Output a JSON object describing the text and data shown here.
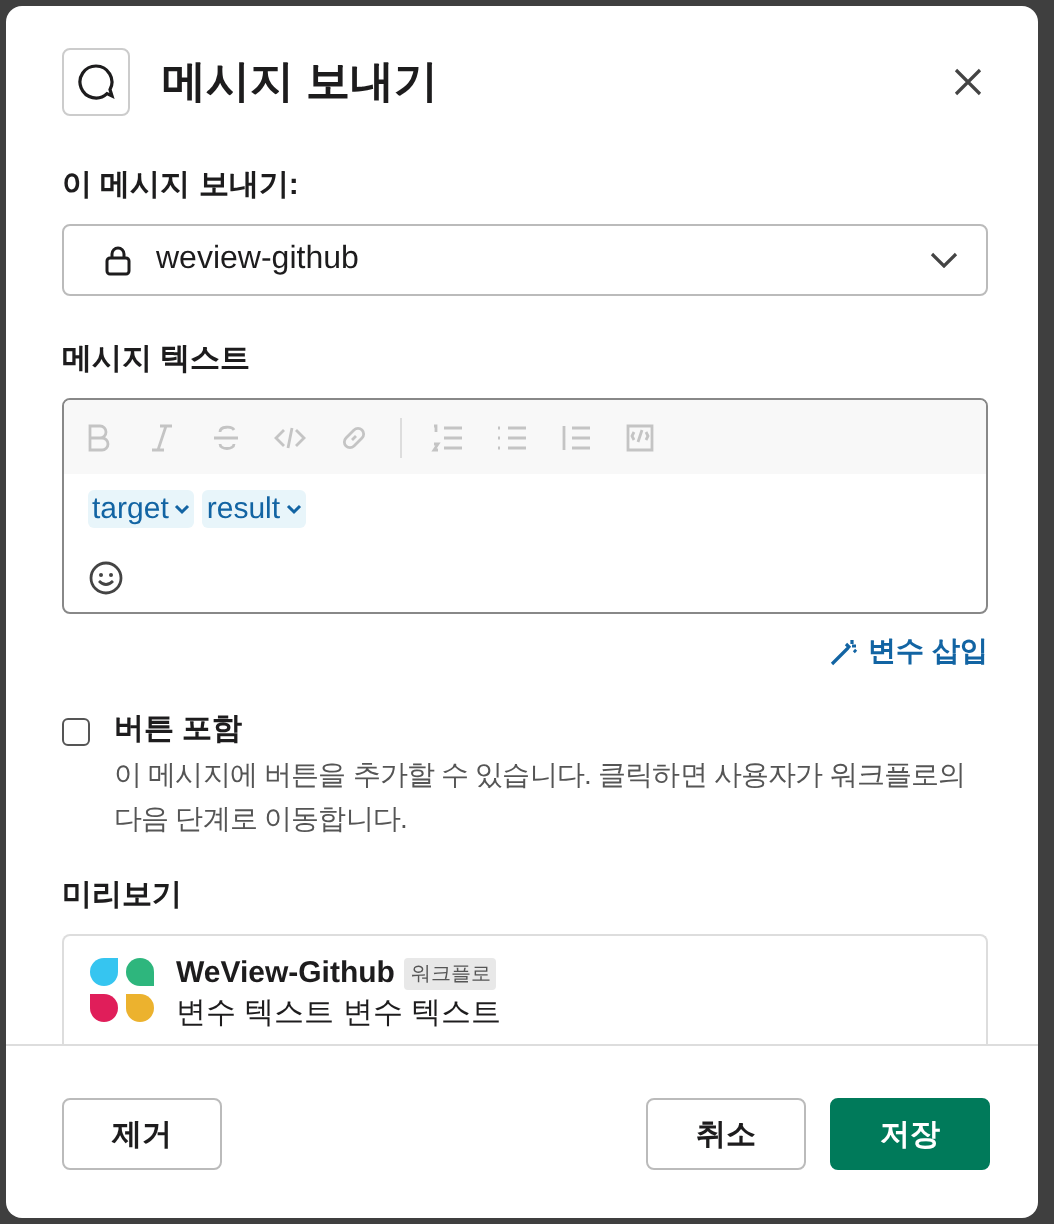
{
  "dialog": {
    "title": "메시지 보내기"
  },
  "recipient": {
    "label": "이 메시지 보내기:",
    "value": "weview-github"
  },
  "message": {
    "label": "메시지 텍스트",
    "toolbar": [
      {
        "kind": "bold",
        "disabled": true
      },
      {
        "kind": "italic",
        "disabled": true
      },
      {
        "kind": "strike",
        "disabled": true
      },
      {
        "kind": "code",
        "disabled": true
      },
      {
        "kind": "link",
        "disabled": true
      },
      {
        "kind": "divider"
      },
      {
        "kind": "ordered",
        "disabled": true
      },
      {
        "kind": "bullet",
        "disabled": true
      },
      {
        "kind": "quote",
        "disabled": true
      },
      {
        "kind": "codeblock",
        "disabled": true
      }
    ],
    "variables": [
      "target",
      "result"
    ],
    "insert_variable": "변수 삽입"
  },
  "include_button": {
    "label": "버튼 포함",
    "checked": false,
    "description": "이 메시지에 버튼을 추가할 수 있습니다. 클릭하면 사용자가 워크플로의 다음 단계로 이동합니다."
  },
  "preview": {
    "label": "미리보기",
    "app_name": "WeView-Github",
    "badge": "워크플로",
    "text": "변수 텍스트 변수 텍스트"
  },
  "buttons": [
    {
      "label": "제거",
      "kind": "secondary"
    },
    {
      "label": "취소",
      "kind": "secondary"
    },
    {
      "label": "저장",
      "kind": "primary"
    }
  ]
}
